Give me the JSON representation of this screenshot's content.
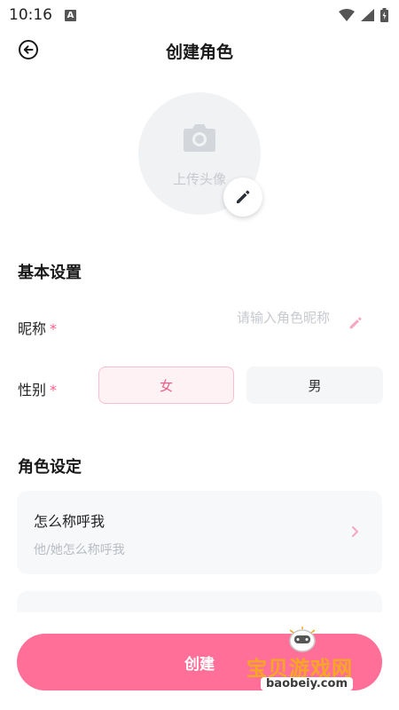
{
  "status_bar": {
    "time": "10:16",
    "badge_letter": "A"
  },
  "header": {
    "title": "创建角色"
  },
  "avatar": {
    "upload_label": "上传头像"
  },
  "basic_settings": {
    "title": "基本设置",
    "nickname_label": "昵称",
    "nickname_placeholder": "请输入角色昵称",
    "nickname_value": "",
    "required_mark": "*",
    "gender_label": "性别",
    "gender_female": "女",
    "gender_male": "男",
    "gender_selected": "女"
  },
  "role_settings": {
    "title": "角色设定",
    "address_title": "怎么称呼我",
    "address_subtitle": "他/她怎么称呼我"
  },
  "footer": {
    "create_label": "创建"
  },
  "watermark": {
    "title": "宝贝游戏网",
    "url": "baobeiy.com"
  },
  "colors": {
    "accent": "#ff6f98",
    "accent_light": "#fff2f5",
    "required": "#ff5c8a"
  }
}
